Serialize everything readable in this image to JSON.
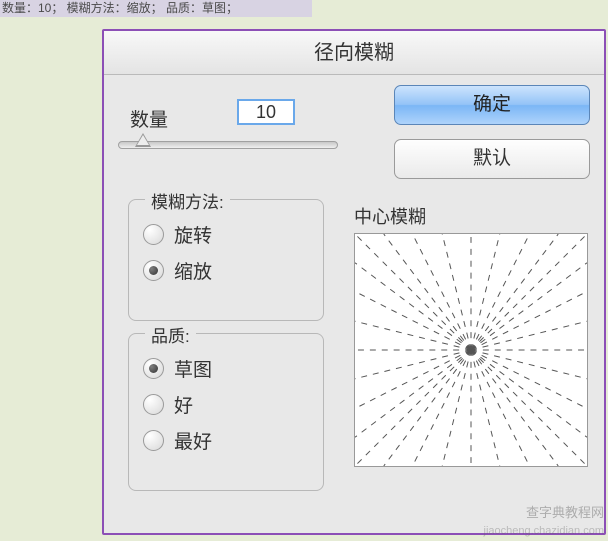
{
  "top_strip": "数量：10；  模糊方法：缩放；  品质：草图；",
  "dialog": {
    "title": "径向模糊",
    "amount_label": "数量",
    "amount_value": "10",
    "ok_label": "确定",
    "default_label": "默认",
    "blur_method": {
      "legend": "模糊方法:",
      "options": [
        {
          "label": "旋转",
          "selected": false
        },
        {
          "label": "缩放",
          "selected": true
        }
      ]
    },
    "quality": {
      "legend": "品质:",
      "options": [
        {
          "label": "草图",
          "selected": true
        },
        {
          "label": "好",
          "selected": false
        },
        {
          "label": "最好",
          "selected": false
        }
      ]
    },
    "center_label": "中心模糊"
  },
  "watermark_main": "查字典教程网",
  "watermark_url": "jiaocheng.chazidian.com"
}
